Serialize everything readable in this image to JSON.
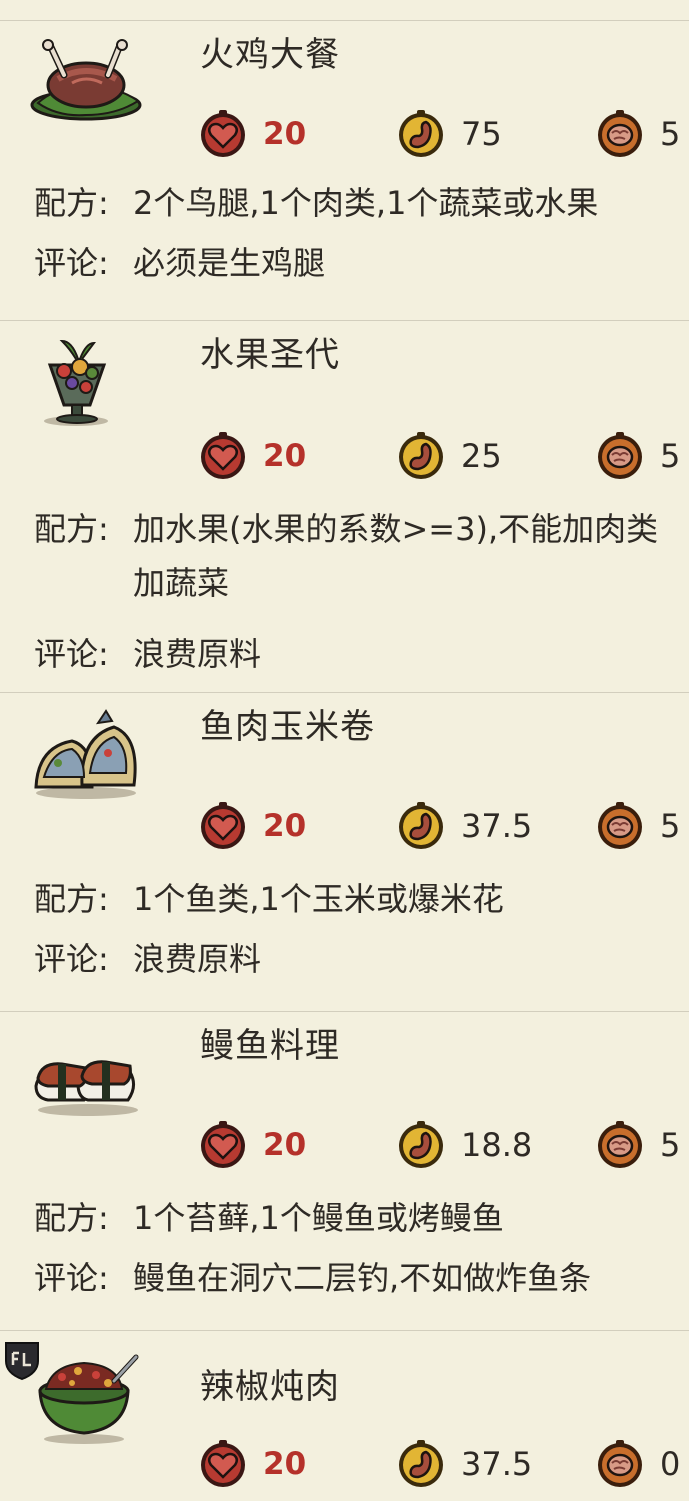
{
  "labels": {
    "recipe": "配方:",
    "comment": "评论:"
  },
  "colors": {
    "background": "#f3f0de",
    "divider": "#d2cebd",
    "health_value": "#b5312a",
    "text": "#2e2a25"
  },
  "icons": {
    "health": "heart-icon",
    "hunger": "stomach-icon",
    "sanity": "brain-icon",
    "badge": "crest-icon"
  },
  "recipes": [
    {
      "name": "火鸡大餐",
      "image": "turkey-dinner-icon",
      "health": "20",
      "hunger": "75",
      "sanity": "5",
      "recipe": "2个鸟腿,1个肉类,1个蔬菜或水果",
      "comment": "必须是生鸡腿"
    },
    {
      "name": "水果圣代",
      "image": "fruit-medley-icon",
      "health": "20",
      "hunger": "25",
      "sanity": "5",
      "recipe": "加水果(水果的系数>=3),不能加肉类\n加蔬菜",
      "comment": "浪费原料"
    },
    {
      "name": "鱼肉玉米卷",
      "image": "fish-tacos-icon",
      "health": "20",
      "hunger": "37.5",
      "sanity": "5",
      "recipe": "1个鱼类,1个玉米或爆米花",
      "comment": "浪费原料"
    },
    {
      "name": "鳗鱼料理",
      "image": "unagi-icon",
      "health": "20",
      "hunger": "18.8",
      "sanity": "5",
      "recipe": "1个苔藓,1个鳗鱼或烤鳗鱼",
      "comment": "鳗鱼在洞穴二层钓,不如做炸鱼条"
    },
    {
      "name": "辣椒炖肉",
      "image": "spicy-chili-icon",
      "health": "20",
      "hunger": "37.5",
      "sanity": "0",
      "recipe": "",
      "comment": ""
    }
  ]
}
